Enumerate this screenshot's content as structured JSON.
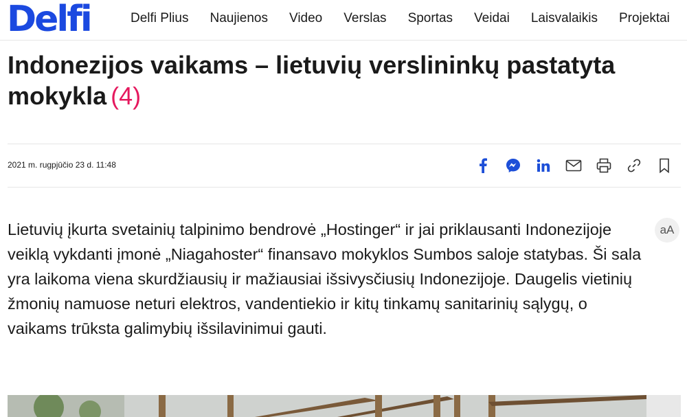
{
  "header": {
    "logo": "Delfi",
    "nav": [
      "Delfi Plius",
      "Naujienos",
      "Video",
      "Verslas",
      "Sportas",
      "Veidai",
      "Laisvalaikis",
      "Projektai"
    ]
  },
  "article": {
    "title": "Indonezijos vaikams – lietuvių verslininkų pastatyta mokykla",
    "comment_count": "(4)",
    "date": "2021 m. rugpjūčio 23 d. 11:48",
    "lead": "Lietuvių įkurta svetainių talpinimo bendrovė „Hostinger“ ir jai priklausanti Indonezijoje veiklą vykdanti įmonė „Niagahoster“ finansavo mokyklos Sumbos saloje statybas. Ši sala yra laikoma viena skurdžiausių ir mažiausiai išsivysčiusių Indonezijoje. Daugelis vietinių žmonių namuose neturi elektros, vandentiekio ir kitų tinkamų sanitarinių sąlygų, o vaikams trūksta galimybių išsilavinimui gauti.",
    "font_size_label": "aA"
  },
  "share_icons": [
    "facebook-icon",
    "messenger-icon",
    "linkedin-icon",
    "email-icon",
    "print-icon",
    "link-icon",
    "bookmark-icon"
  ],
  "colors": {
    "brand": "#1b49e0",
    "accent": "#e5195e",
    "share_icon": "#1d4fd8"
  }
}
